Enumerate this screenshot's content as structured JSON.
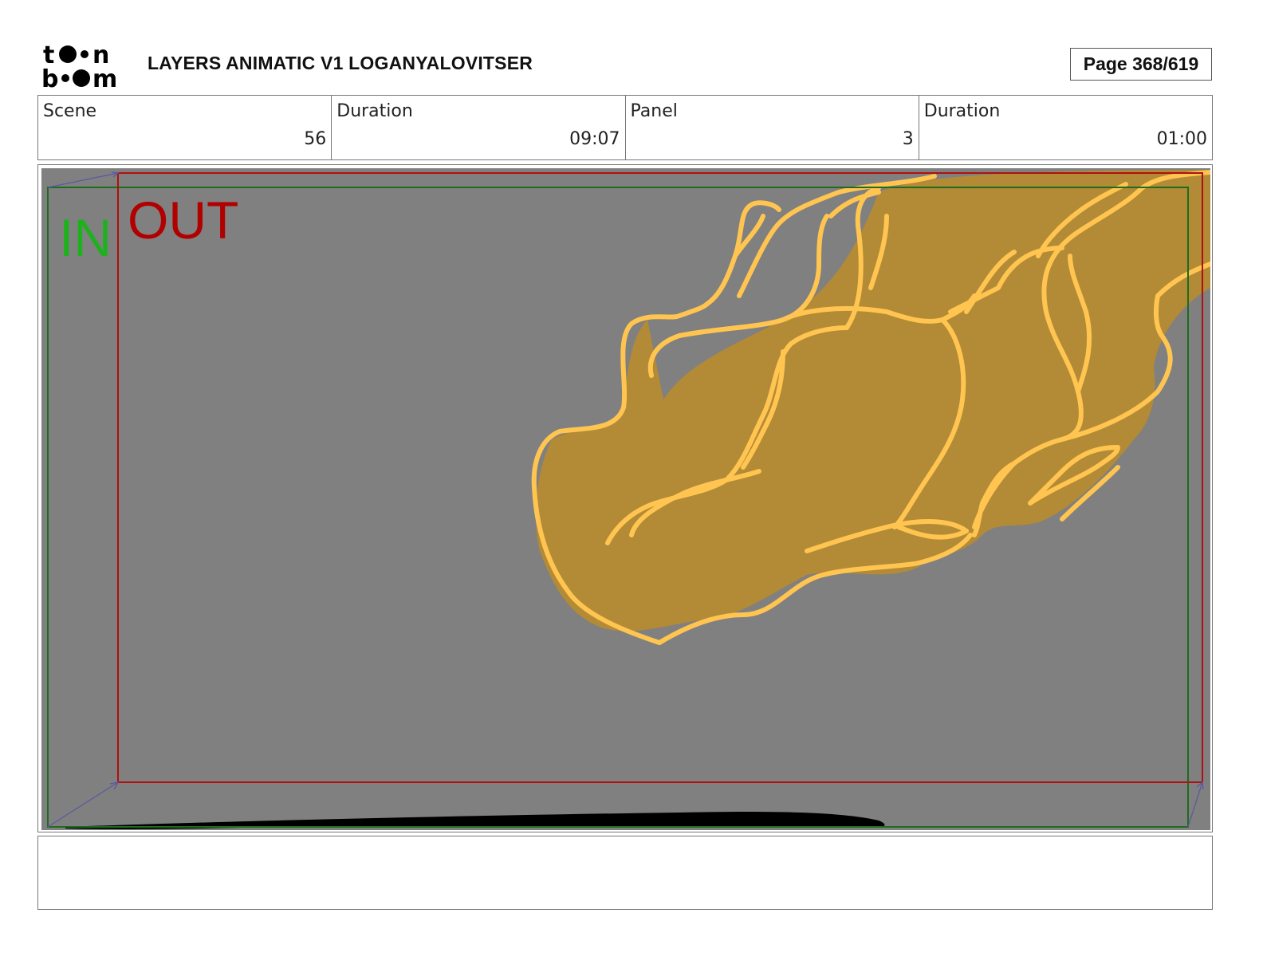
{
  "header": {
    "logo_text": "toon boom",
    "title": "LAYERS ANIMATIC V1 LOGANYALOVITSER",
    "page": "Page 368/619"
  },
  "info": [
    {
      "label": "Scene",
      "value": "56"
    },
    {
      "label": "Duration",
      "value": "09:07"
    },
    {
      "label": "Panel",
      "value": "3"
    },
    {
      "label": "Duration",
      "value": "01:00"
    }
  ],
  "panel": {
    "in_label": "IN",
    "out_label": "OUT",
    "colors": {
      "background": "#808080",
      "in_frame": "#1f6b1f",
      "out_frame": "#b01010",
      "in_text": "#1fb01f",
      "out_text": "#b00000",
      "fill": "#b38a36",
      "stroke": "#ffc550",
      "camera_arrow": "#5a5aa0"
    }
  },
  "caption": {
    "text": ""
  }
}
